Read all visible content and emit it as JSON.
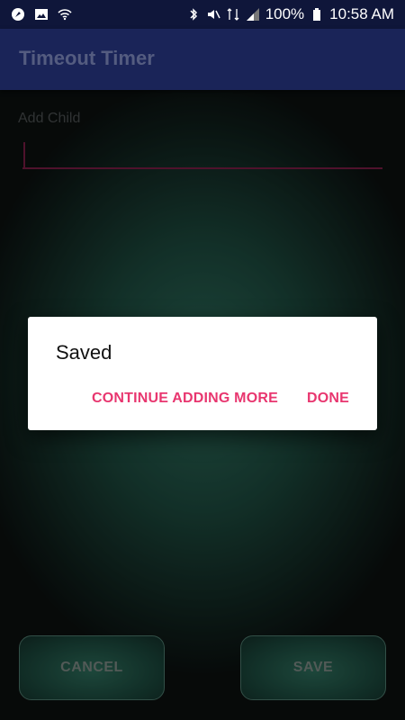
{
  "status_bar": {
    "battery": "100%",
    "time": "10:58 AM",
    "left_icons": [
      "notification-icon",
      "image-icon",
      "wifi-icon"
    ],
    "right_icons": [
      "bluetooth-icon",
      "mute-icon",
      "network-icon",
      "signal-icon",
      "battery-icon"
    ]
  },
  "app_bar": {
    "title": "Timeout Timer"
  },
  "form": {
    "label": "Add Child",
    "input_value": ""
  },
  "buttons": {
    "cancel_label": "CANCEL",
    "save_label": "SAVE"
  },
  "dialog": {
    "title": "Saved",
    "continue_label": "CONTINUE ADDING MORE",
    "done_label": "DONE"
  },
  "colors": {
    "app_bar": "#1a2458",
    "status_bar": "#0f163a",
    "accent": "#e8366f",
    "input_underline": "#7a1d44"
  }
}
